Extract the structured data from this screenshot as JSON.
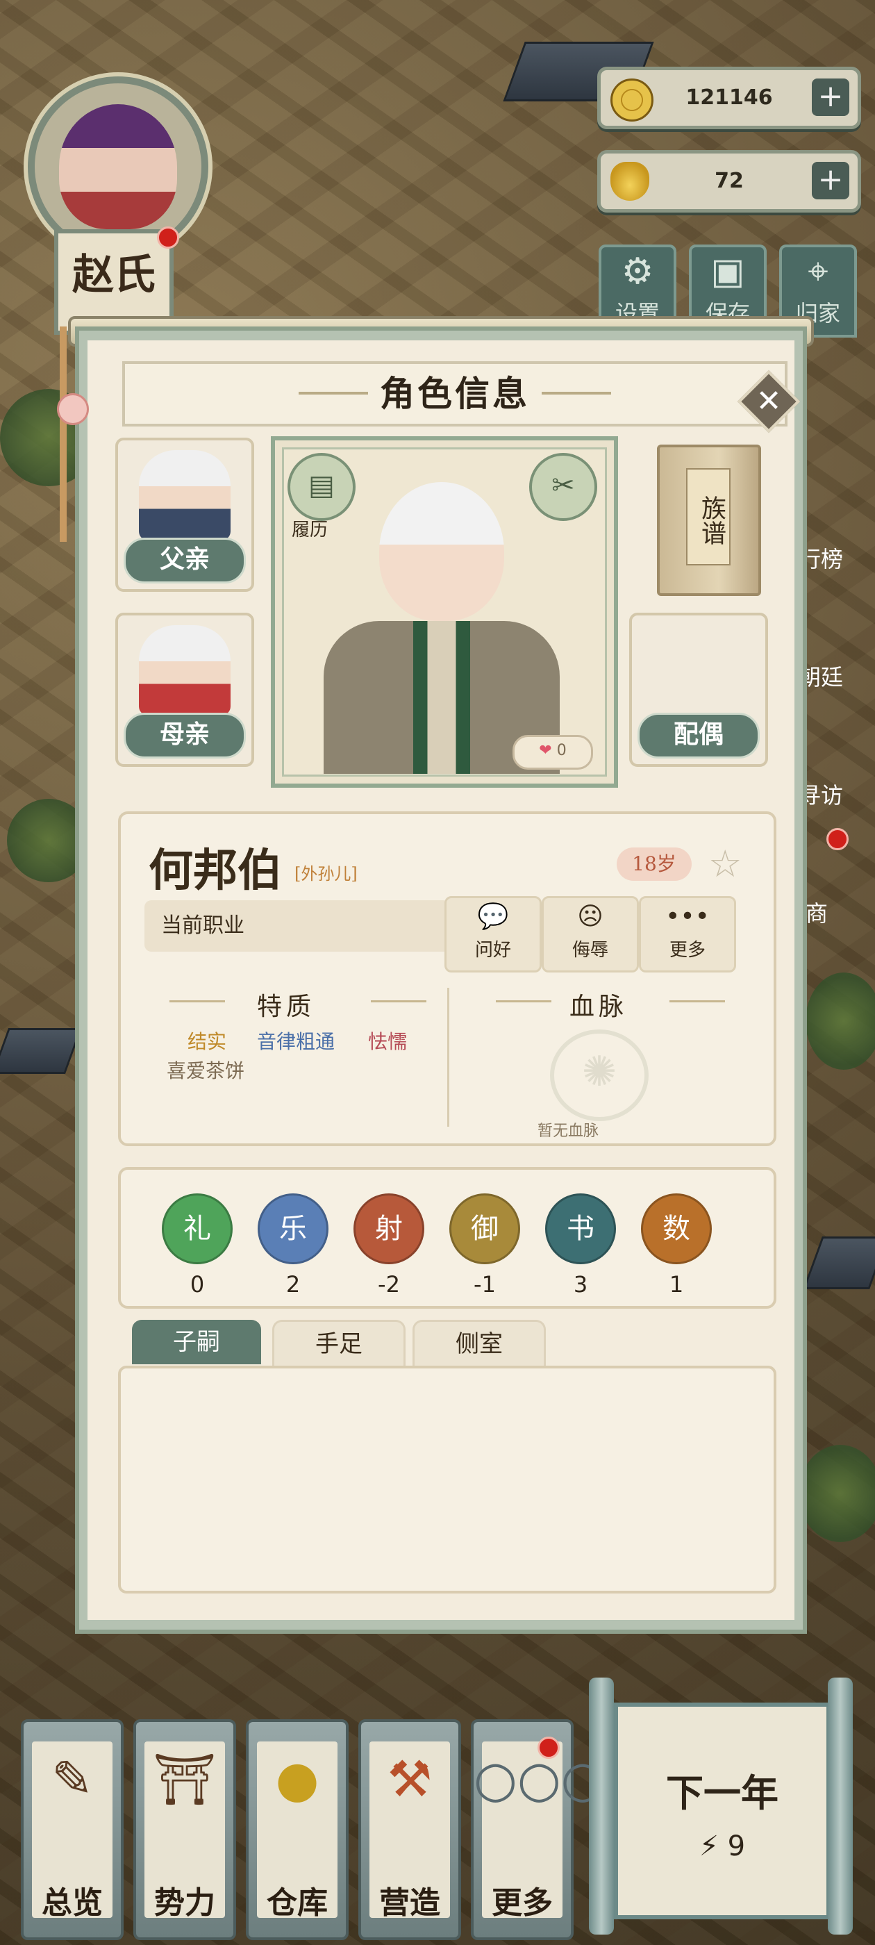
{
  "hud": {
    "player_name": "赵氏",
    "coins": "121146",
    "gold_ingots": "72",
    "top_buttons": [
      {
        "icon": "gear-icon",
        "label": "设置"
      },
      {
        "icon": "save-icon",
        "label": "保存"
      },
      {
        "icon": "map-pin-icon",
        "label": "归家"
      }
    ],
    "side_labels": [
      "行榜",
      "朝廷",
      "寻访",
      "商"
    ]
  },
  "modal": {
    "title": "角色信息",
    "father_label": "父亲",
    "mother_label": "母亲",
    "spouse_label": "配偶",
    "resume_label": "履历",
    "genealogy_label": "族谱",
    "heart_count": "0"
  },
  "character": {
    "name": "何邦伯",
    "relation": "[外孙儿]",
    "age": "18岁",
    "job_label": "当前职业",
    "actions": [
      {
        "icon": "chat-icon",
        "label": "问好"
      },
      {
        "icon": "angry-face-icon",
        "label": "侮辱"
      },
      {
        "icon": "more-icon",
        "label": "更多"
      }
    ],
    "traits_title": "特质",
    "traits": [
      {
        "text": "结实",
        "color": "#c08a2a"
      },
      {
        "text": "音律粗通",
        "color": "#4a6fa8"
      },
      {
        "text": "怯懦",
        "color": "#b54a55"
      },
      {
        "text": "喜爱茶饼",
        "color": "#7d6b53"
      }
    ],
    "bloodline_title": "血脉",
    "bloodline_empty": "暂无血脉"
  },
  "skills": [
    {
      "name": "礼",
      "value": "0",
      "color": "#4fa45a"
    },
    {
      "name": "乐",
      "value": "2",
      "color": "#5a7fb6"
    },
    {
      "name": "射",
      "value": "-2",
      "color": "#b7593a"
    },
    {
      "name": "御",
      "value": "-1",
      "color": "#a88a3a"
    },
    {
      "name": "书",
      "value": "3",
      "color": "#3d6f73"
    },
    {
      "name": "数",
      "value": "1",
      "color": "#b9702a"
    }
  ],
  "tabs": [
    "子嗣",
    "手足",
    "侧室"
  ],
  "bottom_nav": [
    {
      "label": "总览",
      "icon": "brush-icon"
    },
    {
      "label": "势力",
      "icon": "palace-icon"
    },
    {
      "label": "仓库",
      "icon": "bag-icon"
    },
    {
      "label": "营造",
      "icon": "trowel-icon"
    },
    {
      "label": "更多",
      "icon": "more-icon"
    }
  ],
  "next_year": {
    "label": "下一年",
    "energy": "9"
  }
}
